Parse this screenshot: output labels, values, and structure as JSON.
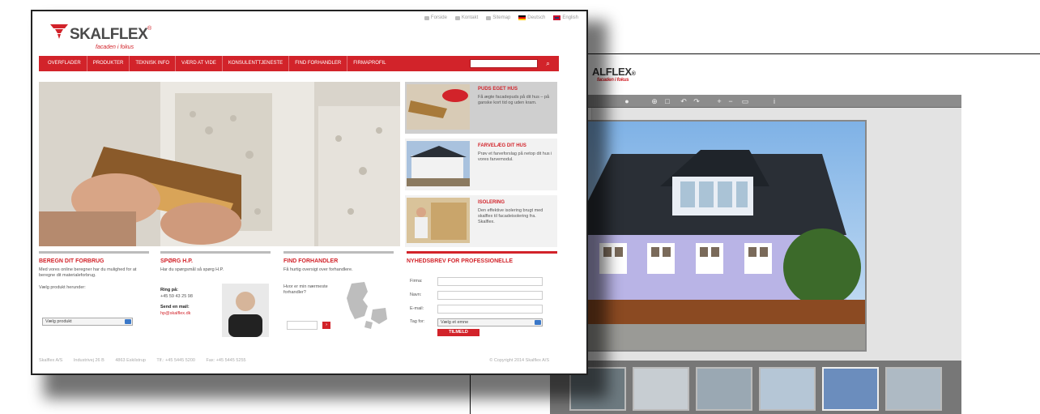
{
  "back_window": {
    "logo_text": "ALFLEX",
    "logo_symbol": "®",
    "logo_tagline": "facaden i fokus"
  },
  "site": {
    "logo": {
      "name": "SKALFLEX",
      "symbol": "®",
      "tagline": "facaden i fokus"
    },
    "toplinks": [
      {
        "label": "Forside",
        "icon": "home-icon"
      },
      {
        "label": "Kontakt",
        "icon": "mail-icon"
      },
      {
        "label": "Sitemap",
        "icon": "sitemap-icon"
      },
      {
        "label": "Deutsch",
        "icon": "flag-de-icon"
      },
      {
        "label": "English",
        "icon": "flag-uk-icon"
      }
    ],
    "nav": [
      "OVERFLADER",
      "PRODUKTER",
      "TEKNISK INFO",
      "VÆRD AT VIDE",
      "KONSULENTTJENESTE",
      "FIND FORHANDLER",
      "FIRMAPROFIL"
    ],
    "search": {
      "placeholder": "",
      "button_icon": "search-icon"
    },
    "promos": [
      {
        "title": "PUDS EGET HUS",
        "text": "Få ægte facadepuds på dit hus – på ganske kort tid og uden kram."
      },
      {
        "title": "FARVELÆG DIT HUS",
        "text": "Prøv et farveforslag på netop dit hus i vores farvemodul."
      },
      {
        "title": "ISOLERING",
        "text": "Den effektive isolering brugt med skalflex til facadeisolering fra. Skalflex."
      }
    ],
    "box_beregn": {
      "title": "BEREGN DIT FORBRUG",
      "text": "Med vores online beregner har du mulighed for at beregne dit materialeforbrug.",
      "prompt": "Vælg produkt herunder:",
      "select": "Vælg produkt"
    },
    "box_sporg": {
      "title": "SPØRG H.P.",
      "text": "Har du spørgsmål så spørg H.P.",
      "phone_label": "Ring på:",
      "phone": "+45 59 43 25 98",
      "mail_label": "Send en mail:",
      "mail": "hp@skalflex.dk"
    },
    "box_find": {
      "title": "FIND FORHANDLER",
      "text": "Få hurtig oversigt over forhandlere.",
      "text2": "Hvor er min nærmeste forhandler?",
      "postnr_placeholder": ""
    },
    "box_nyhed": {
      "title": "NYHEDSBREV FOR PROFESSIONELLE",
      "fields": [
        "Firma:",
        "Navn:",
        "E-mail:",
        "Tag for:"
      ],
      "select": "Vælg et emne",
      "button": "TILMELD"
    },
    "footer": {
      "items": [
        "Skalflex A/S",
        "Industrivej 26 B",
        "4863 Eskilstrup",
        "Tlf.: +45 5445 5200",
        "Fax: +45 5445 5255"
      ],
      "copyright": "© Copyright 2014 Skalflex A/S"
    }
  }
}
